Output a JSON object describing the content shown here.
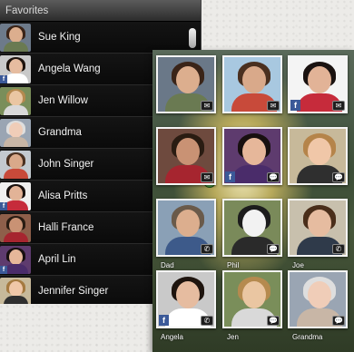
{
  "favorites": {
    "header": "Favorites",
    "contacts": [
      {
        "name": "Sue King",
        "skin": "#dcae8e",
        "hair": "#3a2418",
        "shirt": "#6a7a52",
        "bg": "#6d7a8a",
        "facebook": false
      },
      {
        "name": "Angela Wang",
        "skin": "#e6bca0",
        "hair": "#1e140e",
        "shirt": "#ffffff",
        "bg": "#c9c9c9",
        "facebook": true
      },
      {
        "name": "Jen Willow",
        "skin": "#eac6a2",
        "hair": "#b58a4f",
        "shirt": "#d9d9d9",
        "bg": "#7a8e5a",
        "facebook": false
      },
      {
        "name": "Grandma",
        "skin": "#f0cdb8",
        "hair": "#dedede",
        "shirt": "#c8b6a6",
        "bg": "#9aa5b3",
        "facebook": false
      },
      {
        "name": "John Singer",
        "skin": "#d9a98a",
        "hair": "#4a3020",
        "shirt": "#c84a3a",
        "bg": "#c3c9cf",
        "facebook": false
      },
      {
        "name": "Alisa Pritts",
        "skin": "#e2b397",
        "hair": "#1a1210",
        "shirt": "#c62b3b",
        "bg": "#f0f0f0",
        "facebook": true
      },
      {
        "name": "Halli France",
        "skin": "#c99274",
        "hair": "#2a1c12",
        "shirt": "#a6252f",
        "bg": "#8e5f4a",
        "facebook": false
      },
      {
        "name": "April Lin",
        "skin": "#e6b79a",
        "hair": "#181010",
        "shirt": "#4a2c6a",
        "bg": "#5e3b6e",
        "facebook": true
      },
      {
        "name": "Jennifer Singer",
        "skin": "#f0c7a8",
        "hair": "#a57a40",
        "shirt": "#2f2f2f",
        "bg": "#c7b99a",
        "facebook": false
      }
    ]
  },
  "grid": {
    "tiles": [
      {
        "label": "",
        "badge": "✉",
        "facebook": false,
        "skin": "#dcae8e",
        "hair": "#3a2418",
        "shirt": "#6a7a52",
        "bg": "#6a7888"
      },
      {
        "label": "",
        "badge": "✉",
        "facebook": false,
        "skin": "#d9a98a",
        "hair": "#4a3020",
        "shirt": "#c84a3a",
        "bg": "#a8c8e0"
      },
      {
        "label": "",
        "badge": "✉",
        "facebook": true,
        "skin": "#e2b397",
        "hair": "#1a1210",
        "shirt": "#c62b3b",
        "bg": "#f4f4f4"
      },
      {
        "label": "",
        "badge": "✉",
        "facebook": false,
        "skin": "#c99274",
        "hair": "#2a1c12",
        "shirt": "#a6252f",
        "bg": "#6e4a3e"
      },
      {
        "label": "",
        "badge": "💬",
        "facebook": true,
        "skin": "#e6b79a",
        "hair": "#181010",
        "shirt": "#4a2c6a",
        "bg": "#5e3b6e"
      },
      {
        "label": "",
        "badge": "💬",
        "facebook": false,
        "skin": "#f0c7a8",
        "hair": "#b5844a",
        "shirt": "#2f2f2f",
        "bg": "#c7b99a"
      },
      {
        "label": "Dad",
        "badge": "✆",
        "facebook": false,
        "skin": "#dcae8e",
        "hair": "#6a5a4a",
        "shirt": "#3d5a8a",
        "bg": "#8aa0b6"
      },
      {
        "label": "Phil",
        "badge": "💬",
        "facebook": false,
        "skin": "#f2f2f2",
        "hair": "#1c1c1c",
        "shirt": "#2a2a2a",
        "bg": "#7a8a5a"
      },
      {
        "label": "Joe",
        "badge": "✆",
        "facebook": false,
        "skin": "#e6bca0",
        "hair": "#4a2e1a",
        "shirt": "#2f3a4a",
        "bg": "#c8c0ad"
      },
      {
        "label": "Angela",
        "badge": "✆",
        "facebook": true,
        "skin": "#e6bca0",
        "hair": "#1e140e",
        "shirt": "#ffffff",
        "bg": "#c9c9c9"
      },
      {
        "label": "Jen",
        "badge": "💬",
        "facebook": false,
        "skin": "#eac6a2",
        "hair": "#b58a4f",
        "shirt": "#d9d9d9",
        "bg": "#7a8e5a"
      },
      {
        "label": "Grandma",
        "badge": "💬",
        "facebook": false,
        "skin": "#f0cdb8",
        "hair": "#dedede",
        "shirt": "#c8b6a6",
        "bg": "#9aa5b3"
      }
    ]
  }
}
